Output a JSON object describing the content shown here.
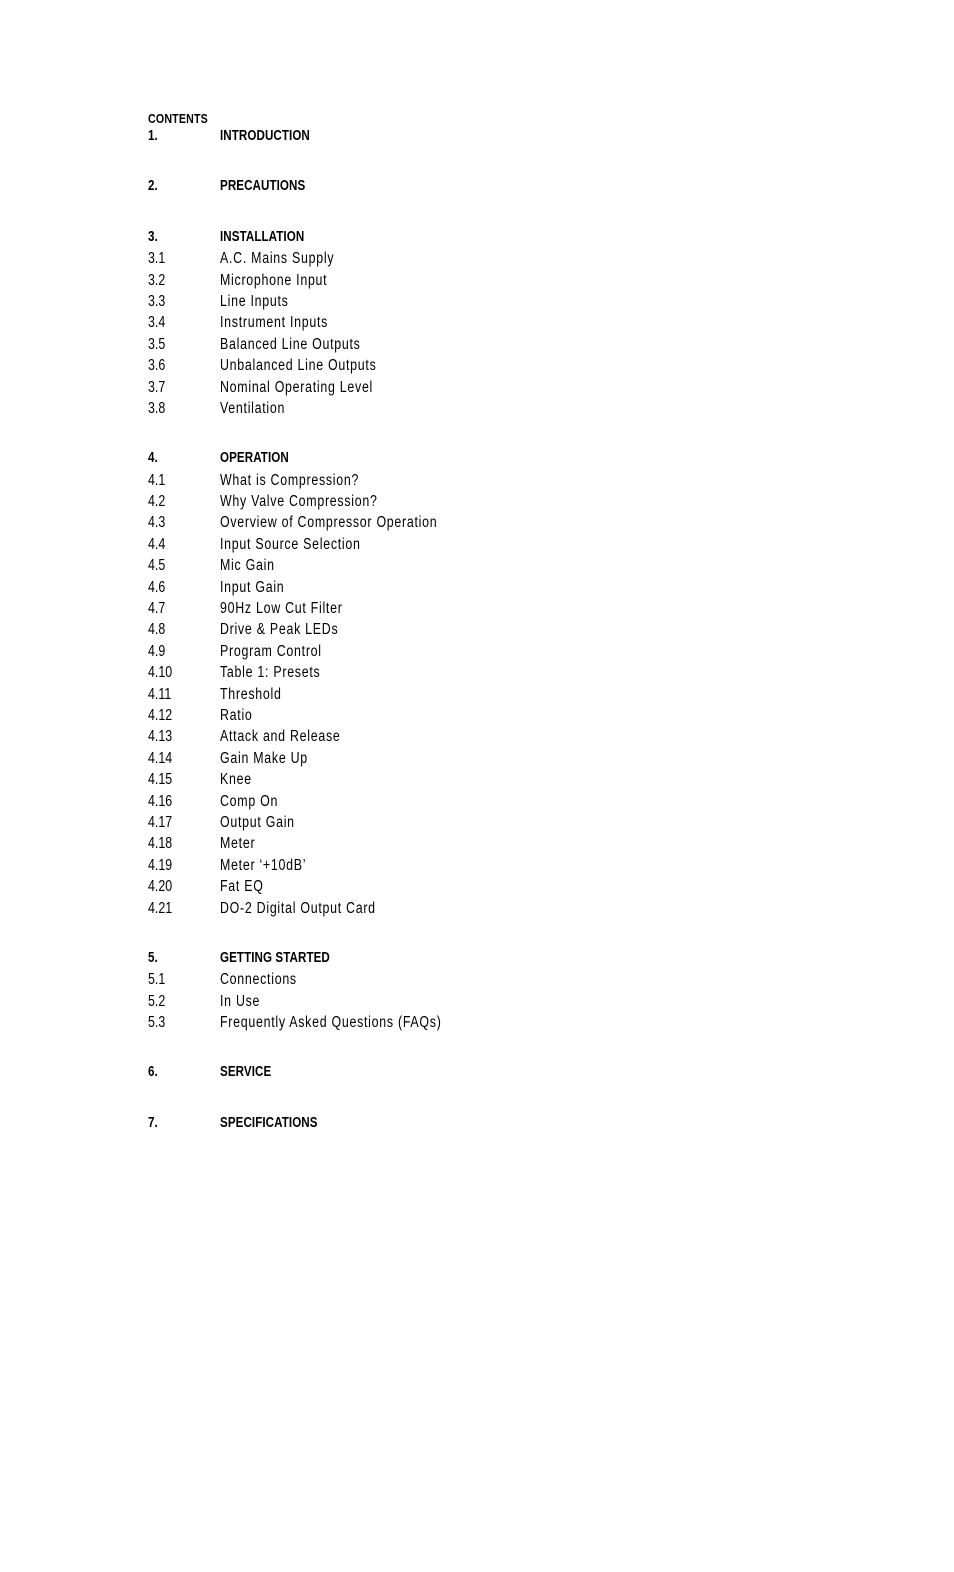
{
  "document": {
    "heading": "CONTENTS"
  },
  "toc": {
    "groups": [
      {
        "entries": [
          {
            "number": "1.",
            "title": "INTRODUCTION",
            "level": "major"
          }
        ]
      },
      {
        "entries": [
          {
            "number": "2.",
            "title": "PRECAUTIONS",
            "level": "major"
          }
        ]
      },
      {
        "entries": [
          {
            "number": "3.",
            "title": "INSTALLATION",
            "level": "major"
          },
          {
            "number": "3.1",
            "title": "A.C. Mains Supply",
            "level": "minor"
          },
          {
            "number": "3.2",
            "title": "Microphone Input",
            "level": "minor"
          },
          {
            "number": "3.3",
            "title": "Line Inputs",
            "level": "minor"
          },
          {
            "number": "3.4",
            "title": "Instrument Inputs",
            "level": "minor"
          },
          {
            "number": "3.5",
            "title": "Balanced Line Outputs",
            "level": "minor"
          },
          {
            "number": "3.6",
            "title": "Unbalanced Line Outputs",
            "level": "minor"
          },
          {
            "number": "3.7",
            "title": "Nominal Operating Level",
            "level": "minor"
          },
          {
            "number": "3.8",
            "title": "Ventilation",
            "level": "minor"
          }
        ]
      },
      {
        "entries": [
          {
            "number": "4.",
            "title": "OPERATION",
            "level": "major"
          },
          {
            "number": "4.1",
            "title": "What is Compression?",
            "level": "minor"
          },
          {
            "number": "4.2",
            "title": "Why Valve Compression?",
            "level": "minor"
          },
          {
            "number": "4.3",
            "title": "Overview of Compressor Operation",
            "level": "minor"
          },
          {
            "number": "4.4",
            "title": "Input Source Selection",
            "level": "minor"
          },
          {
            "number": "4.5",
            "title": "Mic Gain",
            "level": "minor"
          },
          {
            "number": "4.6",
            "title": "Input Gain",
            "level": "minor"
          },
          {
            "number": "4.7",
            "title": "90Hz Low Cut Filter",
            "level": "minor"
          },
          {
            "number": "4.8",
            "title": "Drive & Peak LEDs",
            "level": "minor"
          },
          {
            "number": "4.9",
            "title": "Program Control",
            "level": "minor"
          },
          {
            "number": "4.10",
            "title": "Table 1: Presets",
            "level": "minor"
          },
          {
            "number": "4.11",
            "title": "Threshold",
            "level": "minor"
          },
          {
            "number": "4.12",
            "title": "Ratio",
            "level": "minor"
          },
          {
            "number": "4.13",
            "title": "Attack and Release",
            "level": "minor"
          },
          {
            "number": "4.14",
            "title": "Gain Make Up",
            "level": "minor"
          },
          {
            "number": "4.15",
            "title": "Knee",
            "level": "minor"
          },
          {
            "number": "4.16",
            "title": "Comp On",
            "level": "minor"
          },
          {
            "number": "4.17",
            "title": "Output Gain",
            "level": "minor"
          },
          {
            "number": "4.18",
            "title": "Meter",
            "level": "minor"
          },
          {
            "number": "4.19",
            "title": "Meter ‘+10dB’",
            "level": "minor"
          },
          {
            "number": "4.20",
            "title": "Fat EQ",
            "level": "minor"
          },
          {
            "number": "4.21",
            "title": "DO-2 Digital Output Card",
            "level": "minor"
          }
        ]
      },
      {
        "entries": [
          {
            "number": "5.",
            "title": "GETTING STARTED",
            "level": "major"
          },
          {
            "number": "5.1",
            "title": "Connections",
            "level": "minor"
          },
          {
            "number": "5.2",
            "title": "In Use",
            "level": "minor"
          },
          {
            "number": "5.3",
            "title": "Frequently Asked Questions (FAQs)",
            "level": "minor"
          }
        ]
      },
      {
        "entries": [
          {
            "number": "6.",
            "title": "SERVICE",
            "level": "major"
          }
        ]
      },
      {
        "entries": [
          {
            "number": "7.",
            "title": "SPECIFICATIONS",
            "level": "major"
          }
        ]
      }
    ]
  }
}
